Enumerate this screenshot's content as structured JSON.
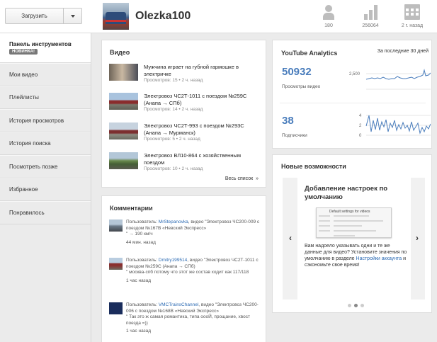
{
  "header": {
    "upload_label": "Загрузить",
    "channel_name": "Olezka100",
    "stats": [
      {
        "icon": "subscribers-icon",
        "value": "180"
      },
      {
        "icon": "views-chart-icon",
        "value": "256064"
      },
      {
        "icon": "calendar-icon",
        "value": "2 г. назад"
      }
    ]
  },
  "sidebar": {
    "active": {
      "label": "Панель инструментов",
      "badge": "НОВИНКА!"
    },
    "items": [
      {
        "label": "Мои видео"
      },
      {
        "label": "Плейлисты"
      },
      {
        "label": "История просмотров"
      },
      {
        "label": "История поиска"
      },
      {
        "label": "Посмотреть позже"
      },
      {
        "label": "Избранное"
      },
      {
        "label": "Понравилось"
      }
    ]
  },
  "videos": {
    "title": "Видео",
    "items": [
      {
        "title": "Мужчина играет на губной гармошке в электричке",
        "views": "Просмотров: 15",
        "age": "2 ч. назад"
      },
      {
        "title": "Электровоз ЧС2Т-1011 с поездом №259С (Анапа → СПб)",
        "views": "Просмотров: 14",
        "age": "2 ч. назад"
      },
      {
        "title": "Электровоз ЧС2Т-993 с поездом №293С (Анапа → Мурманск)",
        "views": "Просмотров: 5",
        "age": "2 ч. назад"
      },
      {
        "title": "Электровоз ВЛ10-864 с хозяйственным поездом",
        "views": "Просмотров: 10",
        "age": "2 ч. назад"
      }
    ],
    "all_list_label": "Весь список",
    "all_list_arrow": "»",
    "meta_separator": "•"
  },
  "comments": {
    "title": "Комментарии",
    "items": [
      {
        "prefix": "Пользователь: ",
        "user": "MrStepanovka",
        "rest": ", видео \"Электровоз ЧС200-009 с поездом №167В «Невский Экспресс»",
        "quote": "\" → 190 км/ч",
        "time": "44 мин. назад"
      },
      {
        "prefix": "Пользователь: ",
        "user": "Dmitry199514",
        "rest": ", видео \"Электровоз ЧС2Т-1011 с поездом №259С (Анапа → СПб)",
        "quote": "\" москва-спб потому что этот же состав ходит как 117/118",
        "time": "1 час назад"
      },
      {
        "prefix": "Пользователь: ",
        "user": "VMCTrainsChannel",
        "rest": ", видео \"Электровоз ЧС200-006 с поездом №168В «Невский Экспресс»",
        "quote": "\" Так это ж самая романтика, типа оооЙ, прощание, хвост поезда =))",
        "time": "1 час назад"
      }
    ]
  },
  "analytics": {
    "title": "YouTube Analytics",
    "period": "За последние 30 дней",
    "views_value": "50932",
    "views_label": "Просмотры видео",
    "views_axis": "2,500",
    "subs_value": "38",
    "subs_label": "Подписчики",
    "subs_axis_top": "4",
    "subs_axis_mid": "2",
    "subs_axis_bottom": "0"
  },
  "features": {
    "title": "Новые возможности",
    "slide_title": "Добавление настроек по умолчанию",
    "shot_title": "Default settings for videos",
    "text_before": "Вам надоело указывать одни и те же данные для видео? Установите значения по умолчанию в разделе ",
    "link_text": "Настройки аккаунта",
    "text_after": " и сэкономьте свое время!",
    "prev_arrow": "‹",
    "next_arrow": "›"
  }
}
